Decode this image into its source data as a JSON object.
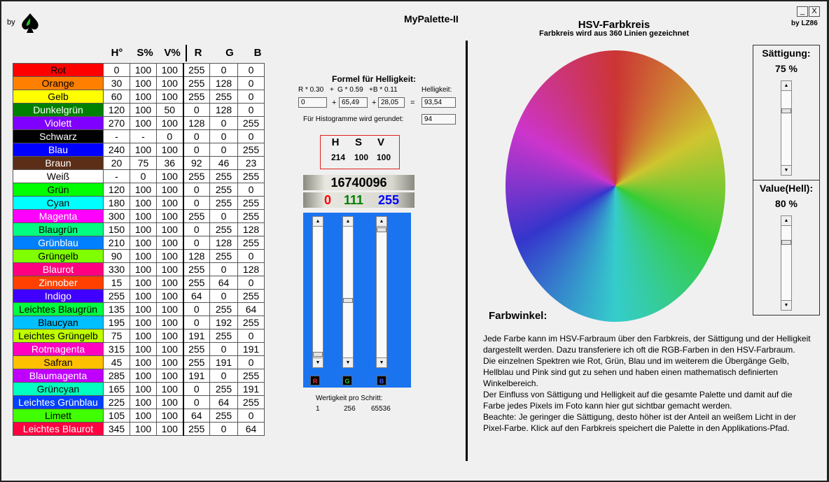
{
  "app": {
    "by": "by",
    "title": "MyPalette-II",
    "by_right": "by LZ86",
    "min_btn": "_",
    "close_btn": "X"
  },
  "hsv_panel": {
    "title": "HSV-Farbkreis",
    "subtitle": "Farbkreis wird aus 360 Linien gezeichnet"
  },
  "table": {
    "headers": [
      "H°",
      "S%",
      "V%",
      "R",
      "G",
      "B"
    ],
    "rows": [
      {
        "name": "Rot",
        "bg": "#ff0000",
        "fg": "#000000",
        "h": "0",
        "s": "100",
        "v": "100",
        "r": "255",
        "g": "0",
        "b": "0"
      },
      {
        "name": "Orange",
        "bg": "#ff8000",
        "fg": "#000000",
        "h": "30",
        "s": "100",
        "v": "100",
        "r": "255",
        "g": "128",
        "b": "0"
      },
      {
        "name": "Gelb",
        "bg": "#ffff00",
        "fg": "#000000",
        "h": "60",
        "s": "100",
        "v": "100",
        "r": "255",
        "g": "255",
        "b": "0"
      },
      {
        "name": "Dunkelgrün",
        "bg": "#008000",
        "fg": "#ffffff",
        "h": "120",
        "s": "100",
        "v": "50",
        "r": "0",
        "g": "128",
        "b": "0"
      },
      {
        "name": "Violett",
        "bg": "#8000ff",
        "fg": "#ffffff",
        "h": "270",
        "s": "100",
        "v": "100",
        "r": "128",
        "g": "0",
        "b": "255"
      },
      {
        "name": "Schwarz",
        "bg": "#000000",
        "fg": "#ffffff",
        "h": "-",
        "s": "-",
        "v": "0",
        "r": "0",
        "g": "0",
        "b": "0"
      },
      {
        "name": "Blau",
        "bg": "#0000ff",
        "fg": "#ffffff",
        "h": "240",
        "s": "100",
        "v": "100",
        "r": "0",
        "g": "0",
        "b": "255"
      },
      {
        "name": "Braun",
        "bg": "#5c2e17",
        "fg": "#ffffff",
        "h": "20",
        "s": "75",
        "v": "36",
        "r": "92",
        "g": "46",
        "b": "23"
      },
      {
        "name": "Weiß",
        "bg": "#ffffff",
        "fg": "#000000",
        "h": "-",
        "s": "0",
        "v": "100",
        "r": "255",
        "g": "255",
        "b": "255"
      },
      {
        "name": "Grün",
        "bg": "#00ff00",
        "fg": "#000000",
        "h": "120",
        "s": "100",
        "v": "100",
        "r": "0",
        "g": "255",
        "b": "0"
      },
      {
        "name": "Cyan",
        "bg": "#00ffff",
        "fg": "#000000",
        "h": "180",
        "s": "100",
        "v": "100",
        "r": "0",
        "g": "255",
        "b": "255"
      },
      {
        "name": "Magenta",
        "bg": "#ff00ff",
        "fg": "#ffffff",
        "h": "300",
        "s": "100",
        "v": "100",
        "r": "255",
        "g": "0",
        "b": "255"
      },
      {
        "name": "Blaugrün",
        "bg": "#00ff80",
        "fg": "#000000",
        "h": "150",
        "s": "100",
        "v": "100",
        "r": "0",
        "g": "255",
        "b": "128"
      },
      {
        "name": "Grünblau",
        "bg": "#0080ff",
        "fg": "#ffffff",
        "h": "210",
        "s": "100",
        "v": "100",
        "r": "0",
        "g": "128",
        "b": "255"
      },
      {
        "name": "Grüngelb",
        "bg": "#80ff00",
        "fg": "#000000",
        "h": "90",
        "s": "100",
        "v": "100",
        "r": "128",
        "g": "255",
        "b": "0"
      },
      {
        "name": "Blaurot",
        "bg": "#ff0080",
        "fg": "#ffffff",
        "h": "330",
        "s": "100",
        "v": "100",
        "r": "255",
        "g": "0",
        "b": "128"
      },
      {
        "name": "Zinnober",
        "bg": "#ff4000",
        "fg": "#ffffff",
        "h": "15",
        "s": "100",
        "v": "100",
        "r": "255",
        "g": "64",
        "b": "0"
      },
      {
        "name": "Indigo",
        "bg": "#4000ff",
        "fg": "#ffffff",
        "h": "255",
        "s": "100",
        "v": "100",
        "r": "64",
        "g": "0",
        "b": "255"
      },
      {
        "name": "Leichtes Blaugrün",
        "bg": "#00ff40",
        "fg": "#000000",
        "h": "135",
        "s": "100",
        "v": "100",
        "r": "0",
        "g": "255",
        "b": "64"
      },
      {
        "name": "Blaucyan",
        "bg": "#00c0ff",
        "fg": "#000000",
        "h": "195",
        "s": "100",
        "v": "100",
        "r": "0",
        "g": "192",
        "b": "255"
      },
      {
        "name": "Leichtes Grüngelb",
        "bg": "#c0ff00",
        "fg": "#000000",
        "h": "75",
        "s": "100",
        "v": "100",
        "r": "191",
        "g": "255",
        "b": "0"
      },
      {
        "name": "Rotmagenta",
        "bg": "#ff00c0",
        "fg": "#ffffff",
        "h": "315",
        "s": "100",
        "v": "100",
        "r": "255",
        "g": "0",
        "b": "191"
      },
      {
        "name": "Safran",
        "bg": "#ffc000",
        "fg": "#000000",
        "h": "45",
        "s": "100",
        "v": "100",
        "r": "255",
        "g": "191",
        "b": "0"
      },
      {
        "name": "Blaumagenta",
        "bg": "#c000ff",
        "fg": "#ffffff",
        "h": "285",
        "s": "100",
        "v": "100",
        "r": "191",
        "g": "0",
        "b": "255"
      },
      {
        "name": "Grüncyan",
        "bg": "#00ffc0",
        "fg": "#000000",
        "h": "165",
        "s": "100",
        "v": "100",
        "r": "0",
        "g": "255",
        "b": "191"
      },
      {
        "name": "Leichtes Grünblau",
        "bg": "#0040ff",
        "fg": "#ffffff",
        "h": "225",
        "s": "100",
        "v": "100",
        "r": "0",
        "g": "64",
        "b": "255"
      },
      {
        "name": "Limett",
        "bg": "#40ff00",
        "fg": "#000000",
        "h": "105",
        "s": "100",
        "v": "100",
        "r": "64",
        "g": "255",
        "b": "0"
      },
      {
        "name": "Leichtes Blaurot",
        "bg": "#ff0040",
        "fg": "#ffffff",
        "h": "345",
        "s": "100",
        "v": "100",
        "r": "255",
        "g": "0",
        "b": "64"
      }
    ]
  },
  "formula": {
    "title": "Formel für Helligkeit:",
    "l_r": "R * 0.30",
    "l_plus1": "+",
    "l_g": "G * 0.59",
    "l_b": "+B  * 0.11",
    "l_hell": "Helligkeit:",
    "v_r": "0",
    "v_g": "65,49",
    "v_b": "28,05",
    "v_hell": "93,54",
    "op_plus": "+",
    "op_eq": "=",
    "round_label": "Für Histogramme wird gerundet:",
    "v_round": "94"
  },
  "hsv_readout": {
    "h_label": "H",
    "s_label": "S",
    "v_label": "V",
    "h": "214",
    "s": "100",
    "v": "100"
  },
  "color_value": {
    "number": "16740096",
    "r": "0",
    "g": "111",
    "b": "255"
  },
  "sliders": {
    "r_label": "R",
    "g_label": "G",
    "b_label": "B",
    "r_value": 0,
    "g_value": 111,
    "b_value": 255,
    "max": 255
  },
  "wert": {
    "label": "Wertigkeit pro Schritt:",
    "v1": "1",
    "v2": "256",
    "v3": "65536"
  },
  "saettigung": {
    "label": "Sättigung:",
    "value": "75 %",
    "level": 75
  },
  "value_hell": {
    "label": "Value(Hell):",
    "value": "80 %",
    "level": 80
  },
  "farbwinkel": {
    "title": "Farbwinkel:",
    "lines": [
      "Jede Farbe kann im HSV-Farbraum über den Farbkreis, der Sättigung und der Helligkeit dargestellt werden. Dazu transferiere ich oft die RGB-Farben in den HSV-Farbraum.",
      "Die einzelnen Spektren wie Rot, Grün, Blau und im weiterem die Übergänge Gelb, Hellblau und Pink sind gut zu sehen und haben einen mathematisch definierten Winkelbereich.",
      "Der Einfluss von Sättigung und Helligkeit auf die gesamte Palette und damit auf die Farbe jedes Pixels im Foto kann hier gut sichtbar gemacht werden.",
      "Beachte: Je geringer die Sättigung, desto höher ist der Anteil an weißem Licht in der Pixel-Farbe. Klick auf den Farbkreis speichert die Palette in den Applikations-Pfad."
    ]
  },
  "colors": {
    "red": "#ff0000",
    "green": "#008000",
    "blue": "#0000ff",
    "panel_blue": "#1a74f0",
    "border_red": "#e02020"
  }
}
